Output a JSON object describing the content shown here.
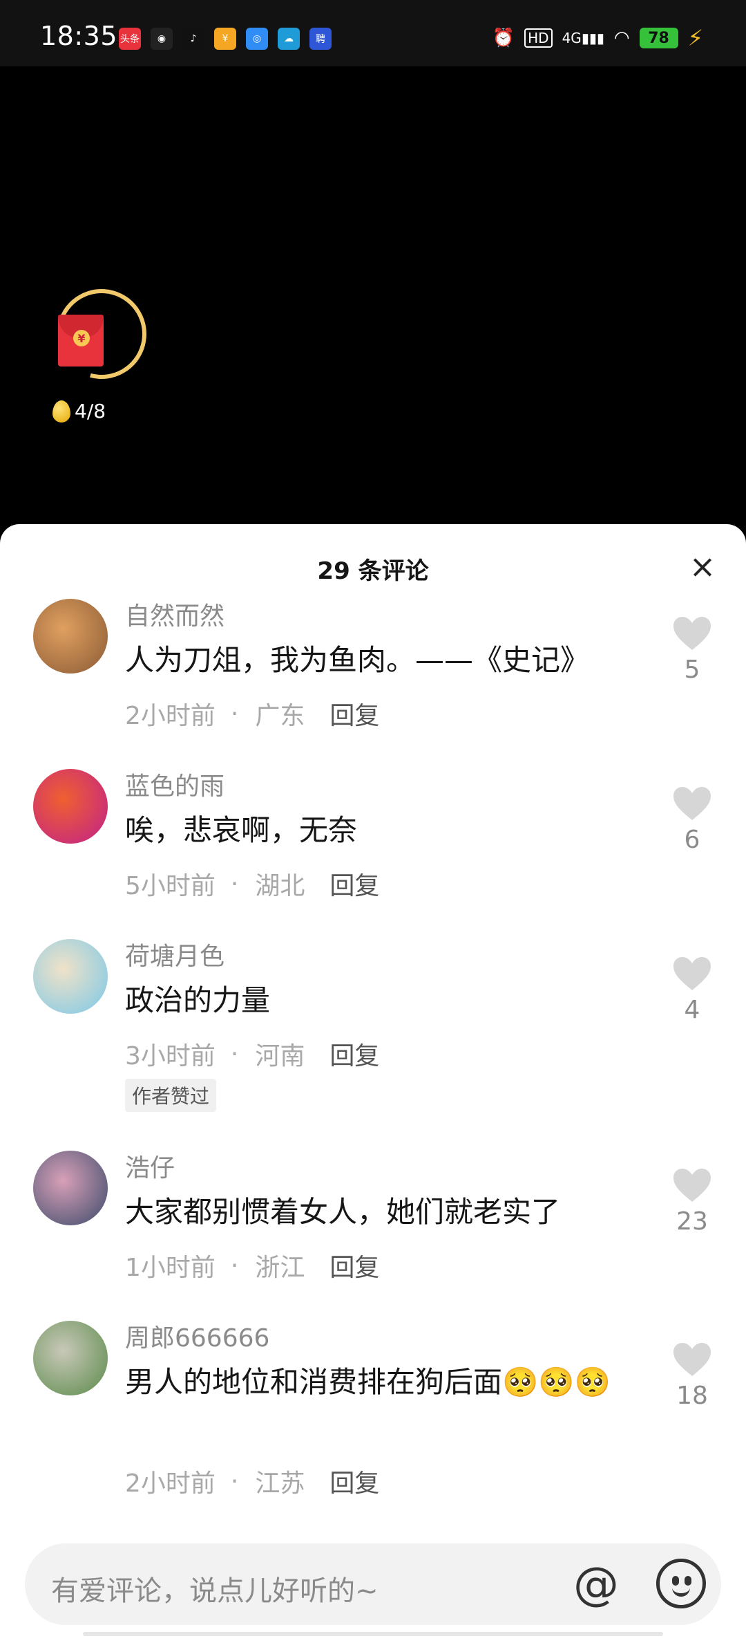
{
  "status_bar": {
    "time": "18:35",
    "network": "4G",
    "hd": "HD",
    "battery": "78",
    "apps": [
      {
        "icon": "toutiao-icon",
        "text": "头条",
        "color": "#e8333c"
      },
      {
        "icon": "speed-icon",
        "text": "◉",
        "color": "#222222"
      },
      {
        "icon": "tiktok-icon",
        "text": "♪",
        "color": "#111111"
      },
      {
        "icon": "sales-icon",
        "text": "¥",
        "color": "#f5a623"
      },
      {
        "icon": "browser-icon",
        "text": "◎",
        "color": "#2f8df5"
      },
      {
        "icon": "cloud-icon",
        "text": "☁",
        "color": "#1f9cd8"
      },
      {
        "icon": "news-icon",
        "text": "聘",
        "color": "#2f56d6"
      }
    ]
  },
  "reward": {
    "progress": "4/8"
  },
  "sheet": {
    "title": "29 条评论",
    "close_label": "×"
  },
  "comments": [
    {
      "user": "自然而然",
      "text": "人为刀俎，我为鱼肉。——《史记》",
      "time": "2小时前",
      "location": "广东",
      "reply": "回复",
      "likes": "5",
      "avatar_colors": [
        "#8a5a34",
        "#e0a060"
      ]
    },
    {
      "user": "蓝色的雨",
      "text": "唉，悲哀啊，无奈",
      "time": "5小时前",
      "location": "湖北",
      "reply": "回复",
      "likes": "6",
      "avatar_colors": [
        "#c0208a",
        "#f06030"
      ]
    },
    {
      "user": "荷塘月色",
      "text": "政治的力量",
      "time": "3小时前",
      "location": "河南",
      "reply": "回复",
      "likes": "4",
      "badge": "作者赞过",
      "avatar_colors": [
        "#7ac8e8",
        "#f0e2c8"
      ]
    },
    {
      "user": "浩仔",
      "text": "大家都别惯着女人，她们就老实了",
      "time": "1小时前",
      "location": "浙江",
      "reply": "回复",
      "likes": "23",
      "avatar_colors": [
        "#3a4a6a",
        "#d8a0b8"
      ]
    },
    {
      "user": "周郎666666",
      "text": "男人的地位和消费排在狗后面🥺🥺🥺",
      "time": "2小时前",
      "location": "江苏",
      "reply": "回复",
      "likes": "18",
      "avatar_colors": [
        "#5a8a4a",
        "#c8c8b8"
      ]
    }
  ],
  "input": {
    "placeholder": "有爱评论，说点儿好听的~",
    "at_label": "@"
  }
}
